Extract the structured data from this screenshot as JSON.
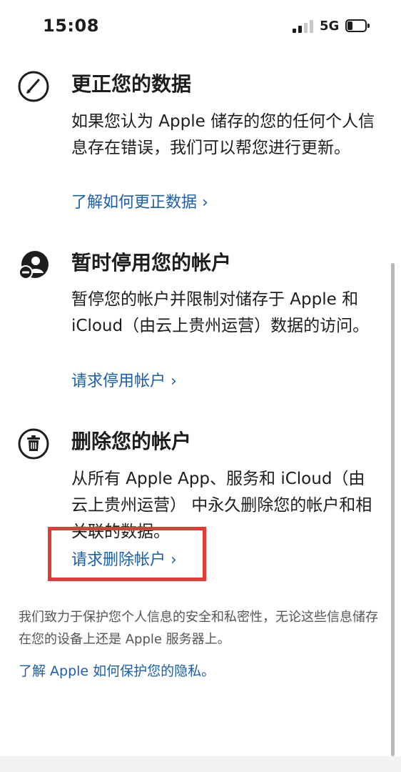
{
  "status_bar": {
    "time": "15:08",
    "network": "5G",
    "signal_bars_active": 2,
    "signal_bars_total": 4,
    "battery_level": 0.3
  },
  "sections": [
    {
      "icon": "pencil-icon",
      "title": "更正您的数据",
      "body": "如果您认为 Apple 储存的您的任何个人信息存在错误，我们可以帮您进行更新。",
      "link": "了解如何更正数据 ›"
    },
    {
      "icon": "user-deactivate-icon",
      "title": "暂时停用您的帐户",
      "body": "暂停您的帐户并限制对储存于 Apple 和 iCloud（由云上贵州运营）数据的访问。",
      "link": "请求停用帐户 ›"
    },
    {
      "icon": "trash-icon",
      "title": "删除您的帐户",
      "body": "从所有 Apple App、服务和 iCloud（由云上贵州运营） 中永久删除您的帐户和相关联的数据。",
      "link": "请求删除帐户 ›"
    }
  ],
  "footer": {
    "text": "我们致力于保护您个人信息的安全和私密性，无论这些信息储存在您的设备上还是 Apple 服务器上。",
    "link": "了解 Apple 如何保护您的隐私。"
  },
  "colors": {
    "link": "#1a5fad",
    "text": "#1d1d1f",
    "highlight": "#e23a36",
    "footer_text": "#555555"
  }
}
